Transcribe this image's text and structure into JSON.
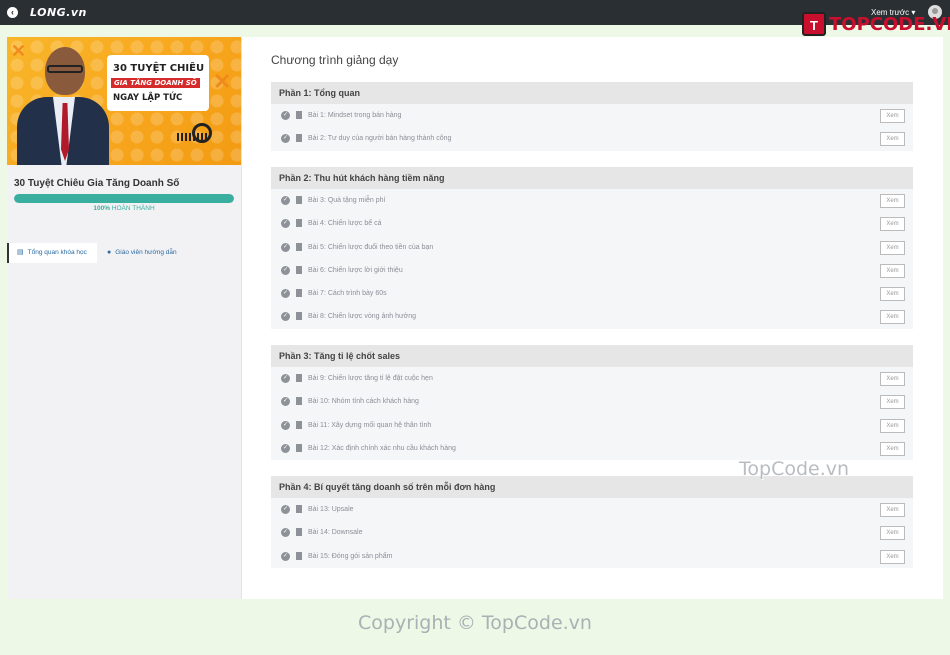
{
  "topbar": {
    "back_icon": "chevron-left-icon",
    "logo": "LONG.vn",
    "preview_label": "Xem trước ▾",
    "avatar_icon": "user-avatar-icon"
  },
  "watermark": {
    "logo_mark": "T",
    "logo_text": "TOPCODE.VN",
    "center_text": "TopCode.vn",
    "copyright": "Copyright © TopCode.vn"
  },
  "sidebar": {
    "banner": {
      "line1": "30 TUYỆT CHIÊU",
      "line2": "GIA TĂNG DOANH SỐ",
      "line3": "NGAY LẬP TỨC"
    },
    "course_title": "30 Tuyệt Chiêu Gia Tăng Doanh Số",
    "progress_percent": "100%",
    "progress_text": "HOÀN THÀNH",
    "progress_value": 100,
    "nav": [
      {
        "label": "Tổng quan khóa học",
        "icon": "list-icon"
      },
      {
        "label": "Giáo viên hướng dẫn",
        "icon": "user-icon"
      }
    ]
  },
  "main": {
    "title": "Chương trình giảng dạy",
    "view_label": "Xem",
    "sections": [
      {
        "title": "Phần 1: Tổng quan",
        "lessons": [
          "Bài 1: Mindset trong bán hàng",
          "Bài 2: Tư duy của người bán hàng thành công"
        ]
      },
      {
        "title": "Phần 2: Thu hút khách hàng tiềm năng",
        "lessons": [
          "Bài 3: Quà tặng miễn phí",
          "Bài 4: Chiến lược bể cá",
          "Bài 5: Chiến lược đuổi theo tiền của bạn",
          "Bài 6: Chiến lược lời giới thiệu",
          "Bài 7: Cách trình bày 60s",
          "Bài 8: Chiến lược vòng ảnh hưởng"
        ]
      },
      {
        "title": "Phần 3: Tăng tỉ lệ chốt sales",
        "lessons": [
          "Bài 9: Chiến lược tăng tỉ lệ đặt cuộc hẹn",
          "Bài 10: Nhóm tính cách khách hàng",
          "Bài 11: Xây dựng mối quan hệ thân tình",
          "Bài 12: Xác định chính xác nhu cầu khách hàng"
        ]
      },
      {
        "title": "Phần 4: Bí quyết tăng doanh số trên mỗi đơn hàng",
        "lessons": [
          "Bài 13: Upsale",
          "Bài 14: Downsale",
          "Bài 15: Đóng gói sản phẩm"
        ]
      }
    ]
  }
}
